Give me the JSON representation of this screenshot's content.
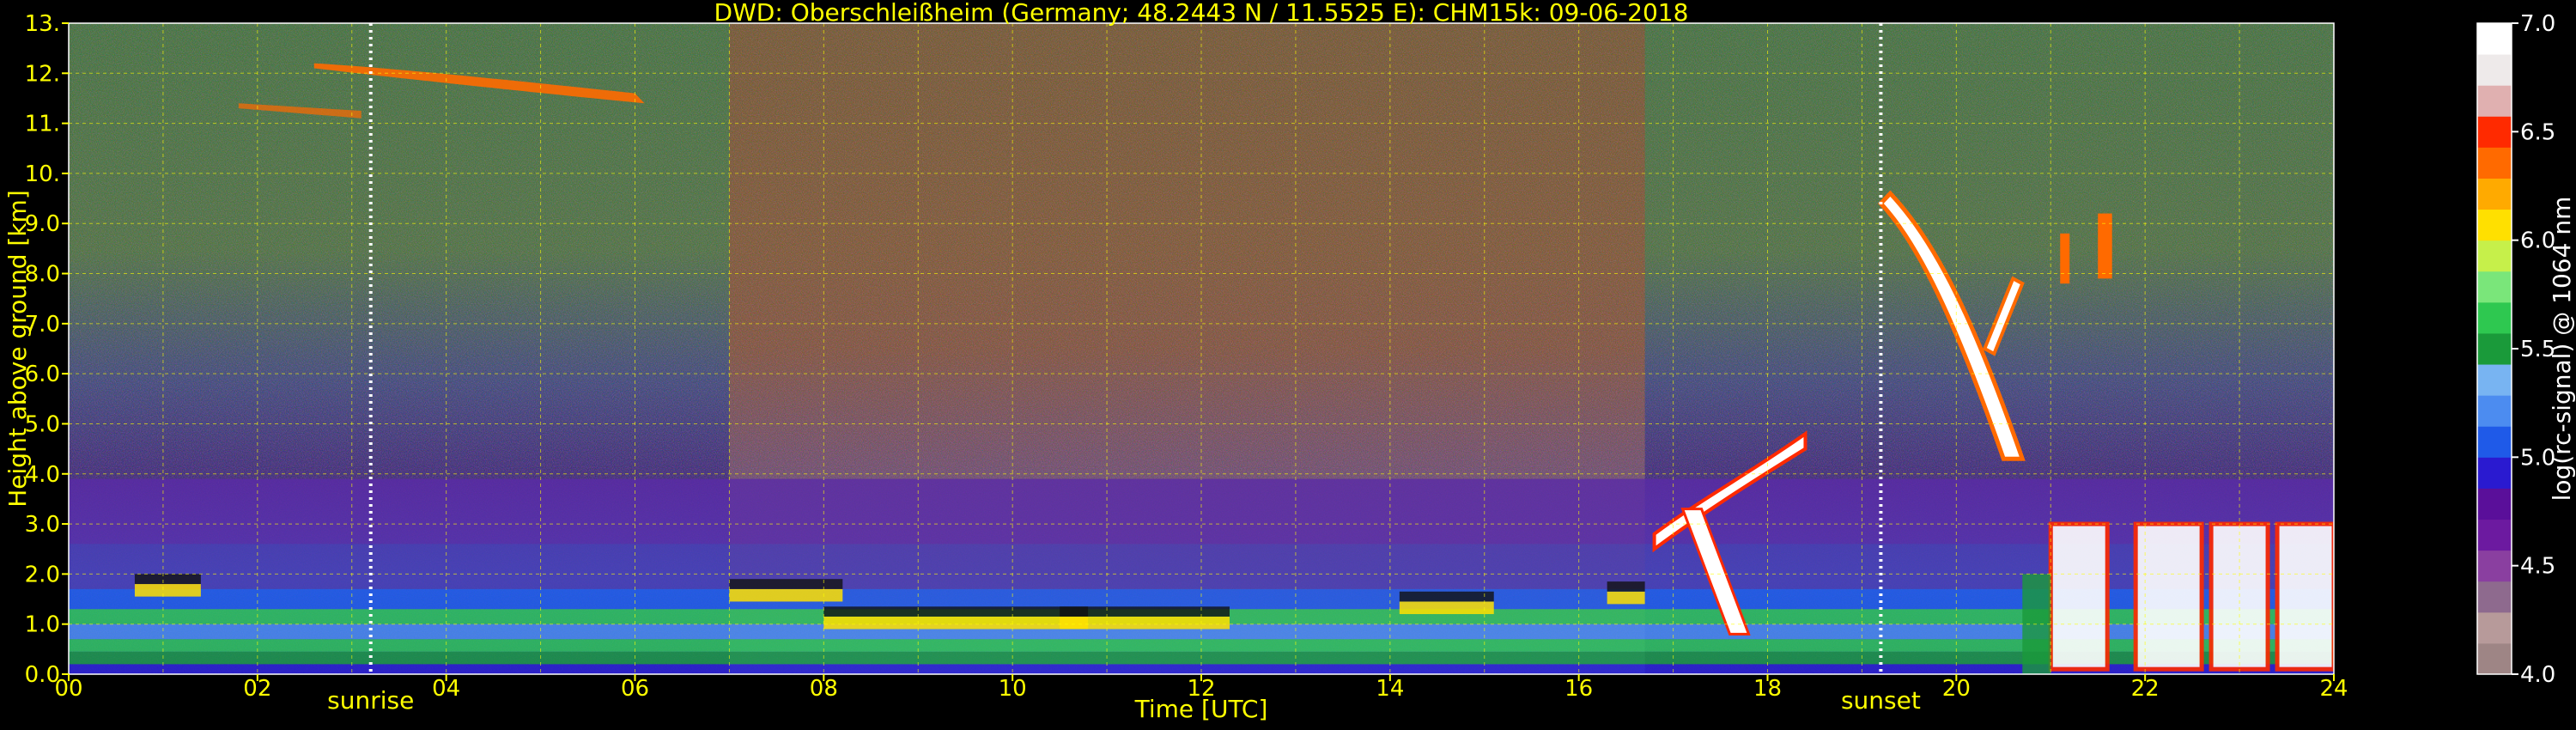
{
  "chart_data": {
    "type": "heatmap",
    "title": "DWD: Oberschleißheim (Germany; 48.2443 N / 11.5525 E):    CHM15k: 09-06-2018",
    "xlabel": "Time [UTC]",
    "ylabel": "Height above ground [km]",
    "x_ticks": [
      "00",
      "02",
      "04",
      "06",
      "08",
      "10",
      "12",
      "14",
      "16",
      "18",
      "20",
      "22",
      "24"
    ],
    "y_ticks": [
      "0.0",
      "1.0",
      "2.0",
      "3.0",
      "4.0",
      "5.0",
      "6.0",
      "7.0",
      "8.0",
      "9.0",
      "10.",
      "11.",
      "12.",
      "13."
    ],
    "xlim": [
      0,
      24
    ],
    "ylim": [
      0,
      13
    ],
    "grid": true,
    "markers": [
      {
        "label": "sunrise",
        "hour": 3.2
      },
      {
        "label": "sunset",
        "hour": 19.2
      }
    ],
    "colorbar": {
      "label": "log(rc-signal) @ 1064 nm",
      "ticks": [
        "4.0",
        "4.5",
        "5.0",
        "5.5",
        "6.0",
        "6.5",
        "7.0"
      ],
      "range": [
        4.0,
        7.0
      ],
      "colors": [
        "#9e8585",
        "#b79a9a",
        "#8e6a8e",
        "#8a3fa0",
        "#6c1aa0",
        "#5a0f9a",
        "#2a1ad0",
        "#1f5ae8",
        "#4c8cf0",
        "#78b4f2",
        "#1a9a3a",
        "#2ec850",
        "#7ae67a",
        "#c6f04a",
        "#ffe000",
        "#ffaa00",
        "#ff6a00",
        "#ff2a00",
        "#e0b0b0",
        "#eeeaea",
        "#ffffff"
      ]
    },
    "features": [
      {
        "name": "boundary layer aerosol",
        "type": "layer"
      },
      {
        "name": "cirrus 02-06h near 12 km",
        "type": "cloud"
      },
      {
        "name": "cloud base ~1.5 km 07-16h",
        "type": "cloud"
      },
      {
        "name": "rising cloud base 16.5-18.5h",
        "type": "cloud"
      },
      {
        "name": "descending cloud 19.2-20.6h",
        "type": "cloud"
      },
      {
        "name": "low cloud 21-24h",
        "type": "cloud"
      }
    ]
  }
}
